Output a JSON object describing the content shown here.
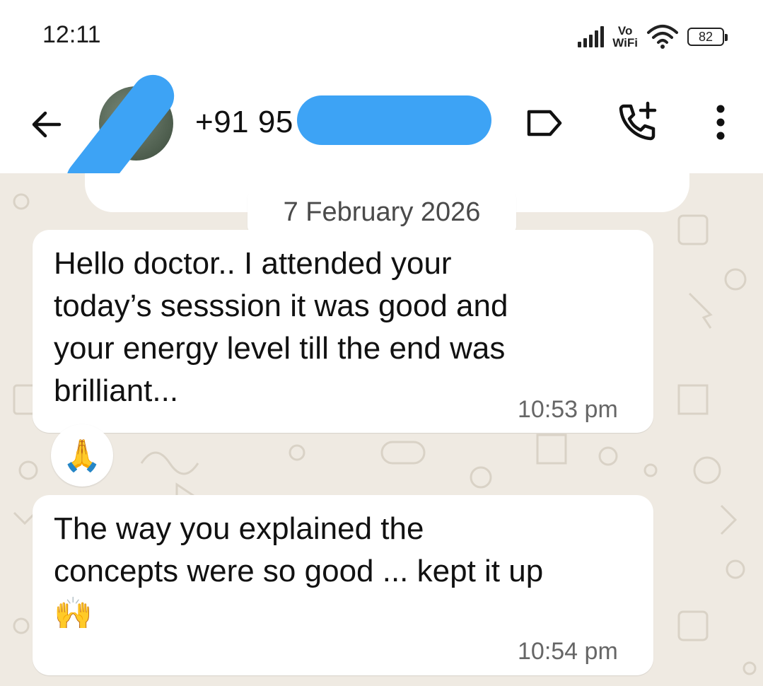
{
  "status_bar": {
    "time": "12:11",
    "network_label_top": "Vo",
    "network_label_bottom": "WiFi",
    "battery": "82"
  },
  "header": {
    "contact_name": "+91 95",
    "icons": [
      "back-arrow-icon",
      "label-icon",
      "add-call-icon",
      "more-vert-icon"
    ]
  },
  "chat": {
    "date_chip": "7 February 2026",
    "messages": [
      {
        "text": "Hello doctor.. I attended your\ntoday’s sesssion it was good and\nyour energy level till the end was\nbrilliant...",
        "time": "10:53 pm",
        "reaction": "🙏"
      },
      {
        "text": "The way you explained the\nconcepts were so good ... kept it up\n🙌",
        "time": "10:54 pm"
      }
    ]
  },
  "colors": {
    "chat_background": "#efeae2",
    "bubble": "#ffffff",
    "redaction": "#3da3f5"
  }
}
